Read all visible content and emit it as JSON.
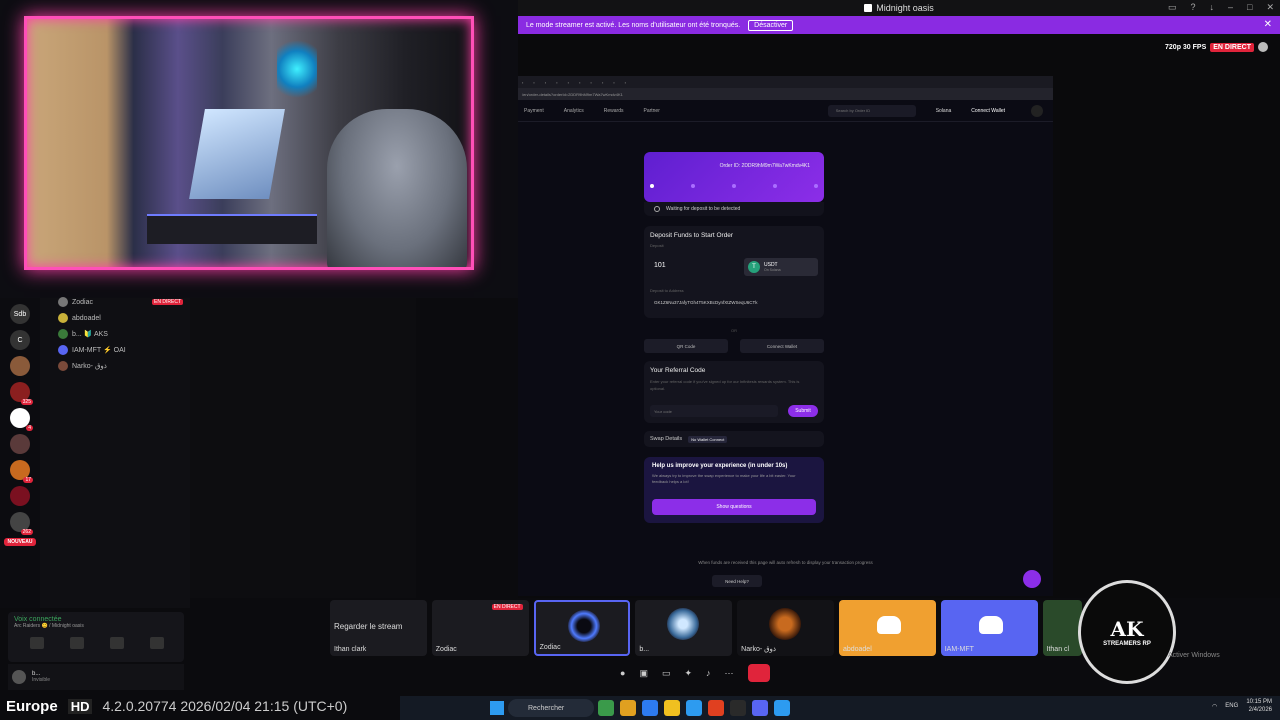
{
  "discord": {
    "window_title": "Midnight oasis",
    "streamer_banner": "Le mode streamer est activé. Les noms d'utilisateur ont été tronqués.",
    "streamer_disable": "Désactiver",
    "stream_quality": "720p 30 FPS",
    "live_label": "EN DIRECT",
    "new_label": "NOUVEAU",
    "voice_connected": "Voix connectée",
    "voice_channel": "Arc Raiders 😊 / Midnight oasis",
    "user_status": "Invisible",
    "user_name": "b...",
    "watch_stream": "Regarder le stream"
  },
  "voice_users": [
    {
      "name": "Zodiac",
      "live": "EN DIRECT"
    },
    {
      "name": "abdoadel",
      "live": ""
    },
    {
      "name": "b... 🔰 AKS",
      "live": ""
    },
    {
      "name": "IAM-MFT ⚡ OAI",
      "live": ""
    },
    {
      "name": "Narko- ذوق",
      "live": ""
    }
  ],
  "servers": [
    {
      "label": "Sdb",
      "badge": ""
    },
    {
      "label": "C",
      "badge": ""
    },
    {
      "label": "",
      "badge": ""
    },
    {
      "label": "",
      "badge": "325"
    },
    {
      "label": "",
      "badge": "4"
    },
    {
      "label": "",
      "badge": ""
    },
    {
      "label": "",
      "badge": "17"
    },
    {
      "label": "",
      "badge": ""
    },
    {
      "label": "",
      "badge": "262"
    }
  ],
  "tiles": [
    {
      "label": "Ithan clark"
    },
    {
      "label": "Zodiac"
    },
    {
      "label": "Zodiac"
    },
    {
      "label": "b..."
    },
    {
      "label": "Narko- ذوق"
    },
    {
      "label": "abdoadel"
    },
    {
      "label": "IAM-MFT"
    },
    {
      "label": "Ithan cl"
    }
  ],
  "website": {
    "nav": [
      "Payment",
      "Analytics",
      "Rewards",
      "Partner"
    ],
    "search_placeholder": "Search by Order ID",
    "network": "Solana",
    "connect_wallet": "Connect Wallet",
    "order_id": "Order ID: 2DDR9hM9m7Wa7wKmdv4K1",
    "waiting": "Waiting for deposit to be detected",
    "deposit_title": "Deposit Funds to Start Order",
    "deposit_sub": "Deposit",
    "amount": "101",
    "token": "USDT",
    "token_network": "On Solana",
    "address_label": "Deposit to Address",
    "address": "GK1Z6Nu37JafyTGh4T5KXBcDynfXtZWSeqU6CTk",
    "or": "OR",
    "qr_code": "QR Code",
    "connect_wallet_btn": "Connect Wallet",
    "referral_title": "Your Referral Code",
    "referral_desc": "Enter your referral code if you've signed up for our Infinitesis rewards system. This is optional.",
    "referral_placeholder": "Your code",
    "submit": "Submit",
    "swap_details": "Swap Details",
    "no_wallet": "No Wallet Connect",
    "help_title": "Help us improve your experience (in under 10s)",
    "help_desc": "We always try to improve the swap experience to make your life a bit easier. Your feedback helps a lot!",
    "show_questions": "Show questions",
    "auto_refresh": "When funds are received this page will auto refresh to display your transaction progress",
    "need_help": "Need Help?",
    "url": "/en/order-details?orderId=2DDR9hM9m7Wa7wKmdv4K1"
  },
  "overlay": {
    "webcam_label": "Zodiac",
    "ak_logo": "AK",
    "ak_sub": "STREAMERS RP",
    "activate": "Activer Windows"
  },
  "info_bar": {
    "region": "Europe",
    "quality": "HD",
    "version": "4.2.0.20774 2026/02/04 21:15 (UTC+0)"
  },
  "taskbar": {
    "search": "Rechercher",
    "lang": "ENG",
    "time": "10:15 PM",
    "date": "2/4/2026"
  },
  "colors": {
    "accent": "#8c2ee8",
    "live": "#e0243b",
    "webcam_border": "#ff4fb8",
    "discord": "#5865f2"
  }
}
